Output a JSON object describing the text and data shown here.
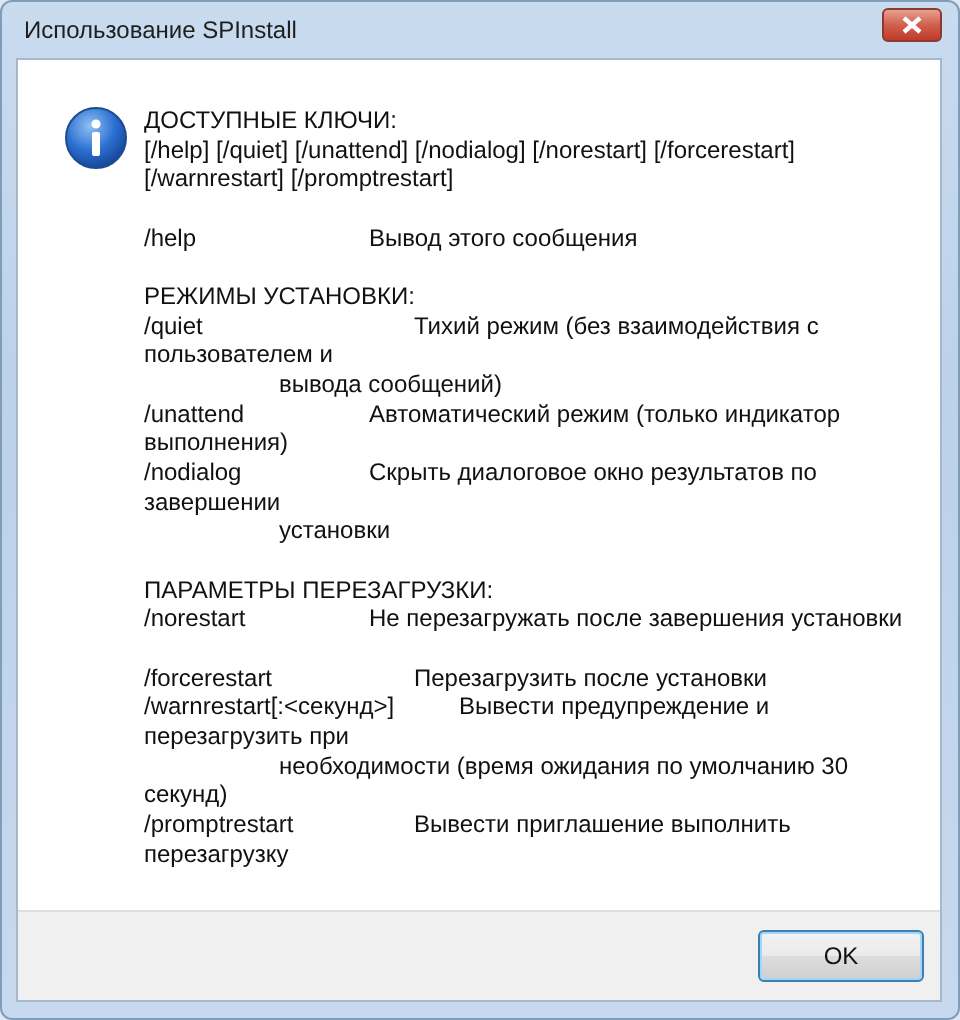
{
  "window": {
    "title": "Использование SPInstall"
  },
  "message": {
    "paragraphs": [
      [
        "ДОСТУПНЫЕ КЛЮЧИ:",
        "[/help] [/quiet] [/unattend] [/nodialog] [/norestart] [/forcerestart]",
        "[/warnrestart] [/promptrestart]"
      ],
      [
        "/help\t\t\t\tВывод этого сообщения"
      ],
      [
        "РЕЖИМЫ УСТАНОВКИ:",
        "/quiet\t\t\t\t\tТихий режим (без взаимодействия с",
        "пользователем и",
        "\t\t\tвывода сообщений)",
        "/unattend\t\t\tАвтоматический режим (только индикатор",
        "выполнения)",
        "/nodialog\t\t\tСкрыть диалоговое окно результатов по",
        "завершении",
        "\t\t\tустановки"
      ],
      [
        "ПАРАМЕТРЫ ПЕРЕЗАГРУЗКИ:",
        "/norestart\t\t\tНе перезагружать после завершения установки"
      ],
      [
        "/forcerestart\t\t\t\tПерезагрузить после установки",
        "/warnrestart[:<секунд>]\t\tВывести предупреждение и",
        "перезагрузить при",
        "\t\t\tнеобходимости (время ожидания по умолчанию 30",
        "секунд)",
        "/promptrestart\t\t\tВывести приглашение выполнить",
        "перезагрузку"
      ]
    ]
  },
  "buttons": [
    "OK"
  ]
}
